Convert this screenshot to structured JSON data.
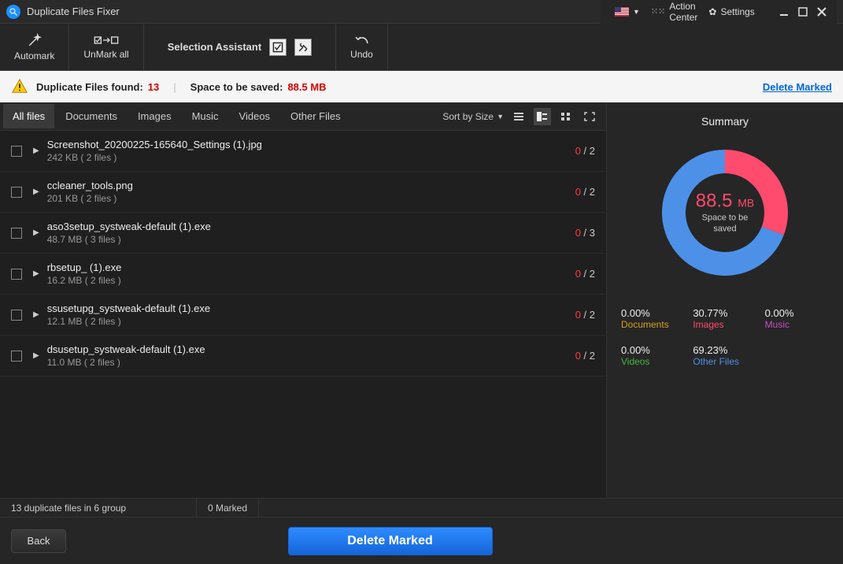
{
  "titlebar": {
    "title": "Duplicate Files Fixer",
    "action_center": "Action Center",
    "settings": "Settings"
  },
  "toolbar": {
    "automark": "Automark",
    "unmark": "UnMark all",
    "assistant": "Selection Assistant",
    "undo": "Undo"
  },
  "infobar": {
    "found_label": "Duplicate Files found:",
    "found_count": "13",
    "space_label": "Space to be saved:",
    "space_value": "88.5 MB",
    "delete_link": "Delete Marked"
  },
  "tabs": {
    "items": [
      "All files",
      "Documents",
      "Images",
      "Music",
      "Videos",
      "Other Files"
    ],
    "sort_label": "Sort by Size"
  },
  "files": [
    {
      "name": "Screenshot_20200225-165640_Settings (1).jpg",
      "size": "242 KB  ( 2 files )",
      "marked": "0",
      "total": "2"
    },
    {
      "name": "ccleaner_tools.png",
      "size": "201 KB  ( 2 files )",
      "marked": "0",
      "total": "2"
    },
    {
      "name": "aso3setup_systweak-default (1).exe",
      "size": "48.7 MB  ( 3 files )",
      "marked": "0",
      "total": "3"
    },
    {
      "name": "rbsetup_ (1).exe",
      "size": "16.2 MB  ( 2 files )",
      "marked": "0",
      "total": "2"
    },
    {
      "name": "ssusetupg_systweak-default (1).exe",
      "size": "12.1 MB  ( 2 files )",
      "marked": "0",
      "total": "2"
    },
    {
      "name": "dsusetup_systweak-default (1).exe",
      "size": "11.0 MB  ( 2 files )",
      "marked": "0",
      "total": "2"
    }
  ],
  "status": {
    "left": "13 duplicate files in 6 group",
    "right": "0 Marked"
  },
  "bottom": {
    "back": "Back",
    "delete": "Delete Marked"
  },
  "summary": {
    "title": "Summary",
    "value": "88.5",
    "unit": "MB",
    "sub": "Space to be saved",
    "legend": [
      {
        "pct": "0.00%",
        "label": "Documents",
        "cls": "lbl-doc"
      },
      {
        "pct": "30.77%",
        "label": "Images",
        "cls": "lbl-img"
      },
      {
        "pct": "0.00%",
        "label": "Music",
        "cls": "lbl-mus"
      },
      {
        "pct": "0.00%",
        "label": "Videos",
        "cls": "lbl-vid"
      },
      {
        "pct": "69.23%",
        "label": "Other Files",
        "cls": "lbl-oth"
      }
    ]
  },
  "chart_data": {
    "type": "pie",
    "title": "Space to be saved",
    "total_label": "88.5 MB",
    "series": [
      {
        "name": "Documents",
        "value": 0.0,
        "color": "#d4a017"
      },
      {
        "name": "Images",
        "value": 30.77,
        "color": "#ff4b6e"
      },
      {
        "name": "Music",
        "value": 0.0,
        "color": "#c050c0"
      },
      {
        "name": "Videos",
        "value": 0.0,
        "color": "#3dbb3d"
      },
      {
        "name": "Other Files",
        "value": 69.23,
        "color": "#4d90e8"
      }
    ]
  }
}
